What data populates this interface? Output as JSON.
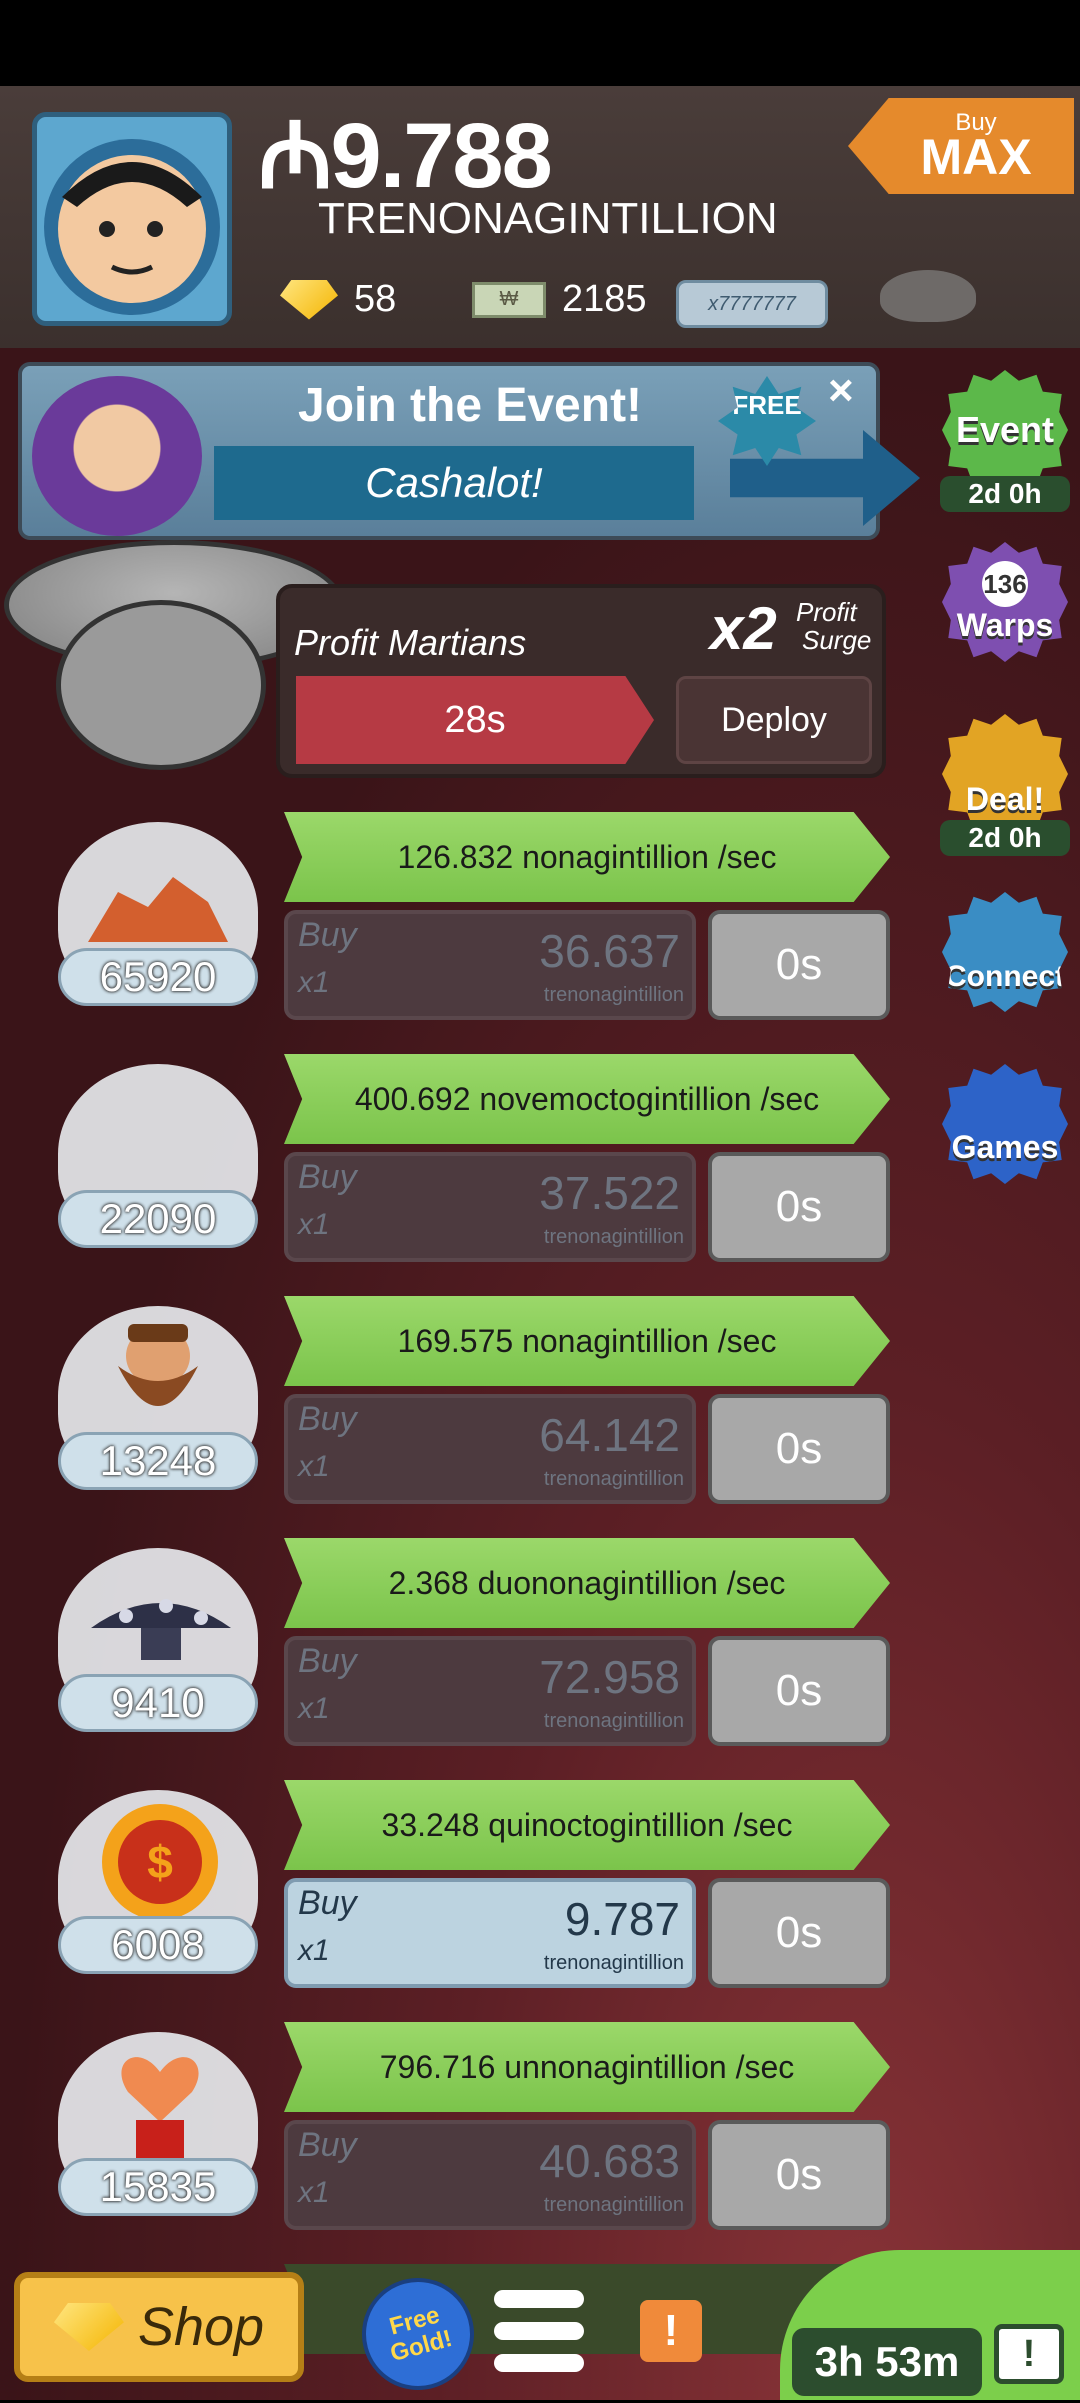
{
  "header": {
    "money_symbol": "₼",
    "money_value": "9.788",
    "money_unit": "TRENONAGINTILLION",
    "gold_count": "58",
    "megabucks_count": "2185",
    "megaticket_label": "x7777777",
    "buy_max": {
      "line1": "Buy",
      "line2": "MAX"
    }
  },
  "event_banner": {
    "title": "Join the Event!",
    "subtitle": "Cashalot!",
    "free_badge": "FREE",
    "close": "×"
  },
  "martians": {
    "title": "Profit Martians",
    "multiplier": "x2",
    "surge_label_1": "Profit",
    "surge_label_2": "Surge",
    "timer": "28s",
    "deploy": "Deploy"
  },
  "side_menu": {
    "event": {
      "label": "Event",
      "sub": "2d 0h"
    },
    "warps": {
      "count": "136",
      "label": "Warps"
    },
    "deal": {
      "label": "Deal!",
      "sub": "2d 0h"
    },
    "connect": {
      "label": "Connect"
    },
    "games": {
      "label": "Games"
    }
  },
  "units": [
    {
      "count": "65920",
      "profit": "126.832 nonagintillion /sec",
      "buy_label": "Buy",
      "buy_mult": "x1",
      "cost": "36.637",
      "cost_unit": "trenonagintillion",
      "time": "0s",
      "affordable": false
    },
    {
      "count": "22090",
      "profit": "400.692 novemoctogintillion /sec",
      "buy_label": "Buy",
      "buy_mult": "x1",
      "cost": "37.522",
      "cost_unit": "trenonagintillion",
      "time": "0s",
      "affordable": false
    },
    {
      "count": "13248",
      "profit": "169.575 nonagintillion /sec",
      "buy_label": "Buy",
      "buy_mult": "x1",
      "cost": "64.142",
      "cost_unit": "trenonagintillion",
      "time": "0s",
      "affordable": false
    },
    {
      "count": "9410",
      "profit": "2.368 duononagintillion /sec",
      "buy_label": "Buy",
      "buy_mult": "x1",
      "cost": "72.958",
      "cost_unit": "trenonagintillion",
      "time": "0s",
      "affordable": false
    },
    {
      "count": "6008",
      "profit": "33.248 quinoctogintillion /sec",
      "buy_label": "Buy",
      "buy_mult": "x1",
      "cost": "9.787",
      "cost_unit": "trenonagintillion",
      "time": "0s",
      "affordable": true
    },
    {
      "count": "15835",
      "profit": "796.716 unnonagintillion /sec",
      "buy_label": "Buy",
      "buy_mult": "x1",
      "cost": "40.683",
      "cost_unit": "trenonagintillion",
      "time": "0s",
      "affordable": false
    }
  ],
  "bottom_bar": {
    "shop": "Shop",
    "free_gold": "Free Gold!",
    "alert": "!",
    "timer": "3h 53m",
    "tv": "!"
  },
  "colors": {
    "profit_bar": "#7bc44b",
    "timer_red": "#b63a44",
    "shop_yellow": "#f7c24a",
    "event_green": "#5cb84a",
    "warps_purple": "#7e4fb0",
    "deal_gold": "#e2a424",
    "connect_blue": "#3a8dc4",
    "games_blue": "#2d63c8"
  }
}
